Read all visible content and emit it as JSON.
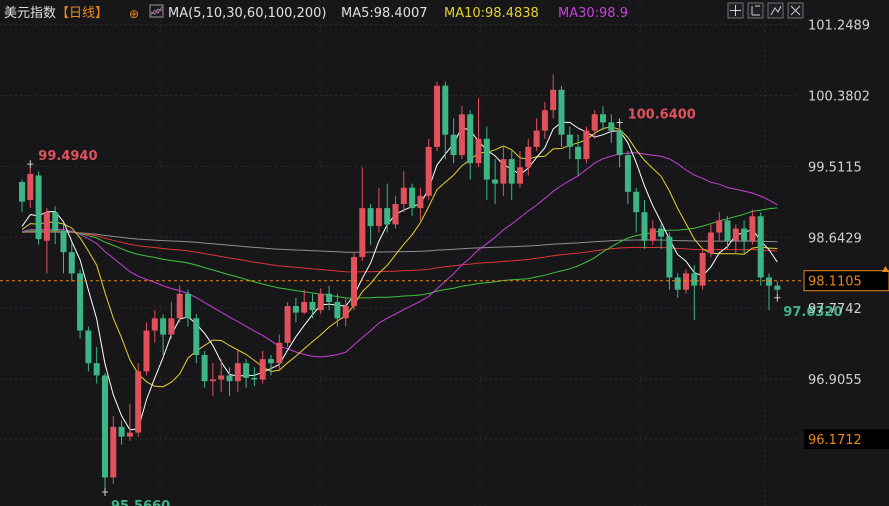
{
  "header": {
    "title": "美元指数",
    "period": "【日线】",
    "indicator_set": "MA(5,10,30,60,100,200)",
    "ma5": "MA5:98.4007",
    "ma10": "MA10:98.4838",
    "ma30": "MA30:98.9"
  },
  "toolbar": {
    "buttons": [
      "crosshair-icon",
      "layout-icon",
      "drawing-icon",
      "close-icon"
    ]
  },
  "colors": {
    "background": "#17171a",
    "grid": "#2c2c30",
    "axis_text": "#d2d2d2",
    "up": "#e0515c",
    "down": "#3fb585",
    "ma5": "#ffffff",
    "ma10": "#e6d12e",
    "ma30": "#c740d8",
    "ma60": "#3fc23f",
    "ma100": "#e03434",
    "ma200": "#8f8f8f",
    "price_line": "#e8891b",
    "title": "#e0e0e0",
    "period": "#e8891b",
    "ma5_text": "#e0e0e0",
    "ma10_text": "#e6d12e",
    "ma30_text": "#c740d8"
  },
  "chart_data": {
    "type": "candlestick",
    "y_axis_ticks": [
      "101.2489",
      "100.3802",
      "99.5115",
      "98.6429",
      "97.7742",
      "96.9055",
      "96.1712"
    ],
    "ylim": [
      95.35,
      101.55
    ],
    "current_price": "98.1105",
    "annotations": [
      {
        "label": "99.4940",
        "bar": 1,
        "kind": "high"
      },
      {
        "label": "95.5660",
        "bar": 10,
        "kind": "low"
      },
      {
        "label": "100.6400",
        "bar": 72,
        "kind": "high"
      },
      {
        "label": "97.6320",
        "bar": 91,
        "kind": "low"
      }
    ],
    "candles": [
      [
        99.32,
        99.08,
        99.35,
        98.95
      ],
      [
        99.1,
        99.42,
        99.49,
        99.0
      ],
      [
        99.4,
        98.62,
        99.45,
        98.55
      ],
      [
        98.6,
        98.95,
        99.0,
        98.2
      ],
      [
        98.95,
        98.72,
        99.02,
        98.56
      ],
      [
        98.72,
        98.46,
        98.8,
        98.2
      ],
      [
        98.46,
        98.2,
        98.58,
        98.1
      ],
      [
        98.2,
        97.5,
        98.25,
        97.4
      ],
      [
        97.5,
        97.1,
        97.55,
        97.0
      ],
      [
        97.1,
        96.95,
        97.3,
        96.85
      ],
      [
        96.95,
        95.7,
        96.98,
        95.57
      ],
      [
        95.7,
        96.32,
        96.45,
        95.62
      ],
      [
        96.32,
        96.2,
        96.4,
        96.1
      ],
      [
        96.2,
        96.25,
        96.6,
        96.15
      ],
      [
        96.25,
        97.0,
        97.1,
        96.2
      ],
      [
        97.0,
        97.5,
        97.6,
        96.95
      ],
      [
        97.5,
        97.65,
        97.75,
        97.35
      ],
      [
        97.65,
        97.45,
        97.7,
        97.2
      ],
      [
        97.45,
        97.65,
        97.85,
        97.4
      ],
      [
        97.65,
        97.95,
        98.05,
        97.6
      ],
      [
        97.95,
        97.65,
        98.0,
        97.55
      ],
      [
        97.65,
        97.2,
        97.7,
        97.1
      ],
      [
        97.2,
        96.88,
        97.25,
        96.8
      ],
      [
        96.88,
        96.9,
        97.1,
        96.7
      ],
      [
        96.9,
        96.95,
        97.15,
        96.75
      ],
      [
        96.95,
        96.88,
        97.05,
        96.7
      ],
      [
        96.88,
        97.1,
        97.25,
        96.75
      ],
      [
        97.1,
        96.92,
        97.15,
        96.8
      ],
      [
        96.92,
        96.9,
        97.05,
        96.82
      ],
      [
        96.9,
        97.15,
        97.25,
        96.85
      ],
      [
        97.15,
        97.1,
        97.2,
        96.95
      ],
      [
        97.1,
        97.35,
        97.45,
        97.0
      ],
      [
        97.35,
        97.8,
        97.85,
        97.3
      ],
      [
        97.8,
        97.72,
        97.9,
        97.6
      ],
      [
        97.72,
        97.85,
        98.0,
        97.7
      ],
      [
        97.85,
        97.75,
        97.95,
        97.65
      ],
      [
        97.75,
        97.95,
        98.02,
        97.7
      ],
      [
        97.95,
        97.85,
        98.05,
        97.75
      ],
      [
        97.85,
        97.65,
        97.95,
        97.55
      ],
      [
        97.65,
        97.8,
        97.9,
        97.55
      ],
      [
        97.8,
        98.4,
        98.45,
        97.75
      ],
      [
        98.4,
        99.0,
        99.5,
        98.35
      ],
      [
        99.0,
        98.78,
        99.05,
        98.55
      ],
      [
        98.78,
        99.0,
        99.25,
        98.7
      ],
      [
        99.0,
        98.8,
        99.3,
        98.7
      ],
      [
        98.8,
        99.05,
        99.15,
        98.75
      ],
      [
        99.05,
        99.25,
        99.45,
        98.95
      ],
      [
        99.25,
        99.0,
        99.3,
        98.9
      ],
      [
        99.0,
        99.15,
        99.25,
        98.85
      ],
      [
        99.15,
        99.75,
        99.85,
        99.1
      ],
      [
        99.75,
        100.5,
        100.55,
        99.7
      ],
      [
        100.5,
        99.9,
        100.55,
        99.6
      ],
      [
        99.9,
        99.65,
        100.1,
        99.55
      ],
      [
        99.65,
        100.15,
        100.25,
        99.6
      ],
      [
        100.15,
        99.55,
        100.2,
        99.35
      ],
      [
        99.55,
        99.85,
        100.35,
        99.5
      ],
      [
        99.85,
        99.35,
        100.0,
        99.1
      ],
      [
        99.35,
        99.3,
        99.6,
        99.05
      ],
      [
        99.3,
        99.6,
        99.75,
        99.15
      ],
      [
        99.6,
        99.3,
        99.7,
        99.1
      ],
      [
        99.3,
        99.5,
        99.7,
        99.25
      ],
      [
        99.5,
        99.75,
        99.85,
        99.4
      ],
      [
        99.75,
        99.95,
        100.1,
        99.7
      ],
      [
        99.95,
        100.2,
        100.3,
        99.85
      ],
      [
        100.2,
        100.45,
        100.64,
        100.1
      ],
      [
        100.45,
        99.9,
        100.5,
        99.75
      ],
      [
        99.9,
        99.75,
        100.0,
        99.6
      ],
      [
        99.75,
        99.6,
        99.9,
        99.4
      ],
      [
        99.6,
        99.95,
        100.0,
        99.55
      ],
      [
        99.95,
        100.15,
        100.2,
        99.85
      ],
      [
        100.15,
        100.05,
        100.25,
        99.95
      ],
      [
        100.05,
        99.95,
        100.15,
        99.8
      ],
      [
        99.95,
        99.65,
        100.0,
        99.5
      ],
      [
        99.65,
        99.2,
        99.7,
        99.05
      ],
      [
        99.2,
        98.95,
        99.25,
        98.7
      ],
      [
        98.95,
        98.6,
        99.1,
        98.5
      ],
      [
        98.6,
        98.75,
        98.85,
        98.55
      ],
      [
        98.75,
        98.65,
        98.8,
        98.5
      ],
      [
        98.65,
        98.15,
        98.7,
        98.0
      ],
      [
        98.15,
        98.0,
        98.2,
        97.9
      ],
      [
        98.0,
        98.2,
        98.25,
        97.95
      ],
      [
        98.2,
        98.05,
        98.3,
        97.63
      ],
      [
        98.05,
        98.45,
        98.5,
        98.0
      ],
      [
        98.45,
        98.7,
        98.8,
        98.4
      ],
      [
        98.7,
        98.85,
        98.95,
        98.6
      ],
      [
        98.85,
        98.6,
        98.9,
        98.5
      ],
      [
        98.6,
        98.75,
        98.8,
        98.45
      ],
      [
        98.75,
        98.6,
        98.85,
        98.45
      ],
      [
        98.6,
        98.9,
        98.98,
        98.55
      ],
      [
        98.9,
        98.15,
        98.95,
        98.05
      ],
      [
        98.15,
        98.05,
        98.2,
        97.75
      ],
      [
        98.05,
        98.0,
        98.1,
        97.95
      ]
    ]
  }
}
